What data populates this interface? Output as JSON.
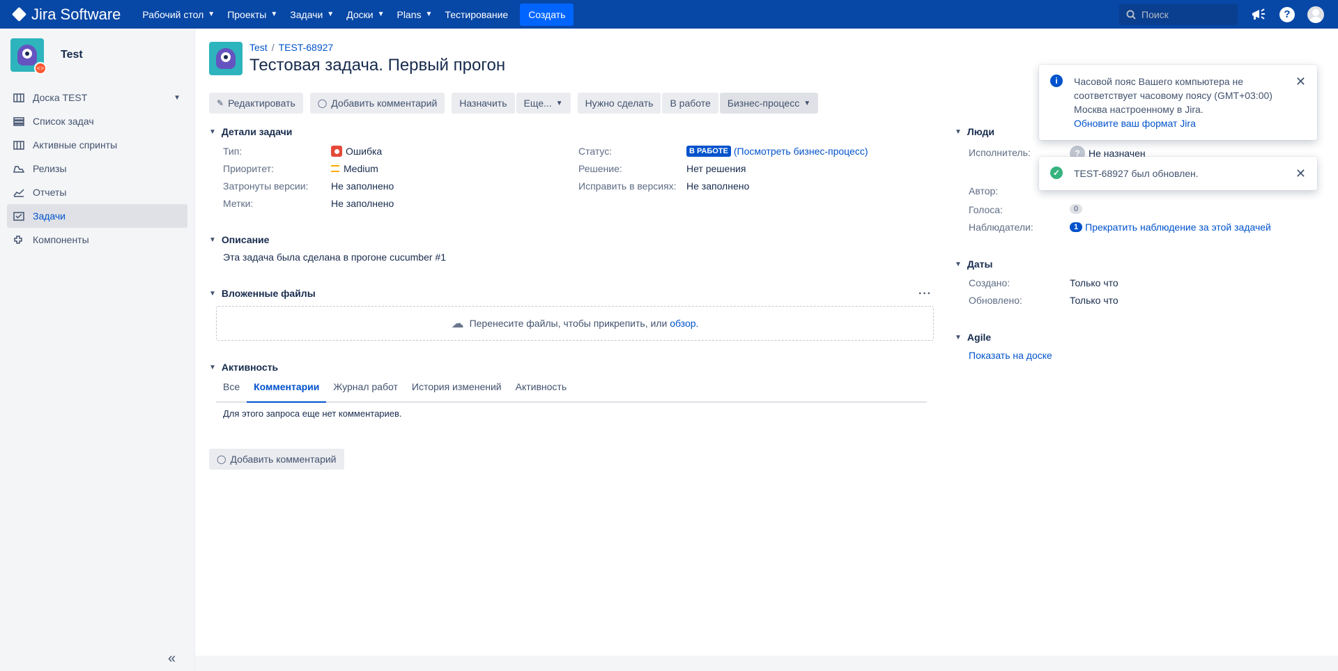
{
  "topbar": {
    "product": "Jira Software",
    "nav": [
      {
        "label": "Рабочий стол",
        "has_menu": true
      },
      {
        "label": "Проекты",
        "has_menu": true
      },
      {
        "label": "Задачи",
        "has_menu": true
      },
      {
        "label": "Доски",
        "has_menu": true
      },
      {
        "label": "Plans",
        "has_menu": true
      },
      {
        "label": "Тестирование",
        "has_menu": false
      }
    ],
    "create_label": "Создать",
    "search_placeholder": "Поиск",
    "icons": [
      "notifications-megaphone-icon",
      "help-icon",
      "user-avatar-icon"
    ]
  },
  "sidebar": {
    "project_name": "Test",
    "items": [
      {
        "label": "Доска TEST",
        "icon": "board-icon",
        "active": false,
        "expandable": true
      },
      {
        "label": "Список задач",
        "icon": "backlog-icon",
        "active": false
      },
      {
        "label": "Активные спринты",
        "icon": "sprints-icon",
        "active": false
      },
      {
        "label": "Релизы",
        "icon": "releases-icon",
        "active": false
      },
      {
        "label": "Отчеты",
        "icon": "reports-icon",
        "active": false
      },
      {
        "label": "Задачи",
        "icon": "issues-icon",
        "active": true
      },
      {
        "label": "Компоненты",
        "icon": "components-icon",
        "active": false
      }
    ]
  },
  "issue": {
    "breadcrumb_project": "Test",
    "breadcrumb_key": "TEST-68927",
    "title": "Тестовая задача. Первый прогон"
  },
  "toolbar": {
    "edit": "Редактировать",
    "add_comment": "Добавить комментарий",
    "assign": "Назначить",
    "more": "Еще...",
    "todo": "Нужно сделать",
    "in_progress": "В работе",
    "workflow": "Бизнес-процесс"
  },
  "details": {
    "heading": "Детали задачи",
    "type_label": "Тип:",
    "type_value": "Ошибка",
    "priority_label": "Приоритет:",
    "priority_value": "Medium",
    "affects_label": "Затронуты версии:",
    "affects_value": "Не заполнено",
    "labels_label": "Метки:",
    "labels_value": "Не заполнено",
    "status_label": "Статус:",
    "status_value": "В РАБОТЕ",
    "status_link": "Посмотреть бизнес-процесс",
    "resolution_label": "Решение:",
    "resolution_value": "Нет решения",
    "fix_label": "Исправить в версиях:",
    "fix_value": "Не заполнено"
  },
  "description": {
    "heading": "Описание",
    "text": "Эта задача была сделана в прогоне cucumber #1"
  },
  "attachments": {
    "heading": "Вложенные файлы",
    "drop_text": "Перенесите файлы, чтобы прикрепить, или",
    "browse": "обзор."
  },
  "activity": {
    "heading": "Активность",
    "tabs": [
      "Все",
      "Комментарии",
      "Журнал работ",
      "История изменений",
      "Активность"
    ],
    "active_tab": "Комментарии",
    "empty": "Для этого запроса еще нет комментариев.",
    "add_comment": "Добавить комментарий"
  },
  "people": {
    "heading": "Люди",
    "assignee_label": "Исполнитель:",
    "assignee_value": "Не назначен",
    "reporter_label": "Автор:",
    "votes_label": "Голоса:",
    "votes_value": "0",
    "watchers_label": "Наблюдатели:",
    "watchers_count": "1",
    "watchers_link": "Прекратить наблюдение за этой задачей"
  },
  "dates": {
    "heading": "Даты",
    "created_label": "Создано:",
    "created_value": "Только что",
    "updated_label": "Обновлено:",
    "updated_value": "Только что"
  },
  "agile": {
    "heading": "Agile",
    "link": "Показать на доске"
  },
  "flags": [
    {
      "type": "info",
      "lines": [
        "Часовой пояс Вашего компьютера не",
        "соответствует часовому поясу (GMT+03:00)",
        "Москва настроенному в Jira."
      ],
      "link": "Обновите ваш формат Jira"
    },
    {
      "type": "success",
      "text": "TEST-68927 был обновлен."
    }
  ],
  "colors": {
    "topbar": "#0747a6",
    "create_button": "#0065ff",
    "link": "#0052cc",
    "status_lozenge": "#0052cc",
    "bug": "#e5493a",
    "priority_medium": "#ffab00",
    "success": "#36b37e"
  }
}
